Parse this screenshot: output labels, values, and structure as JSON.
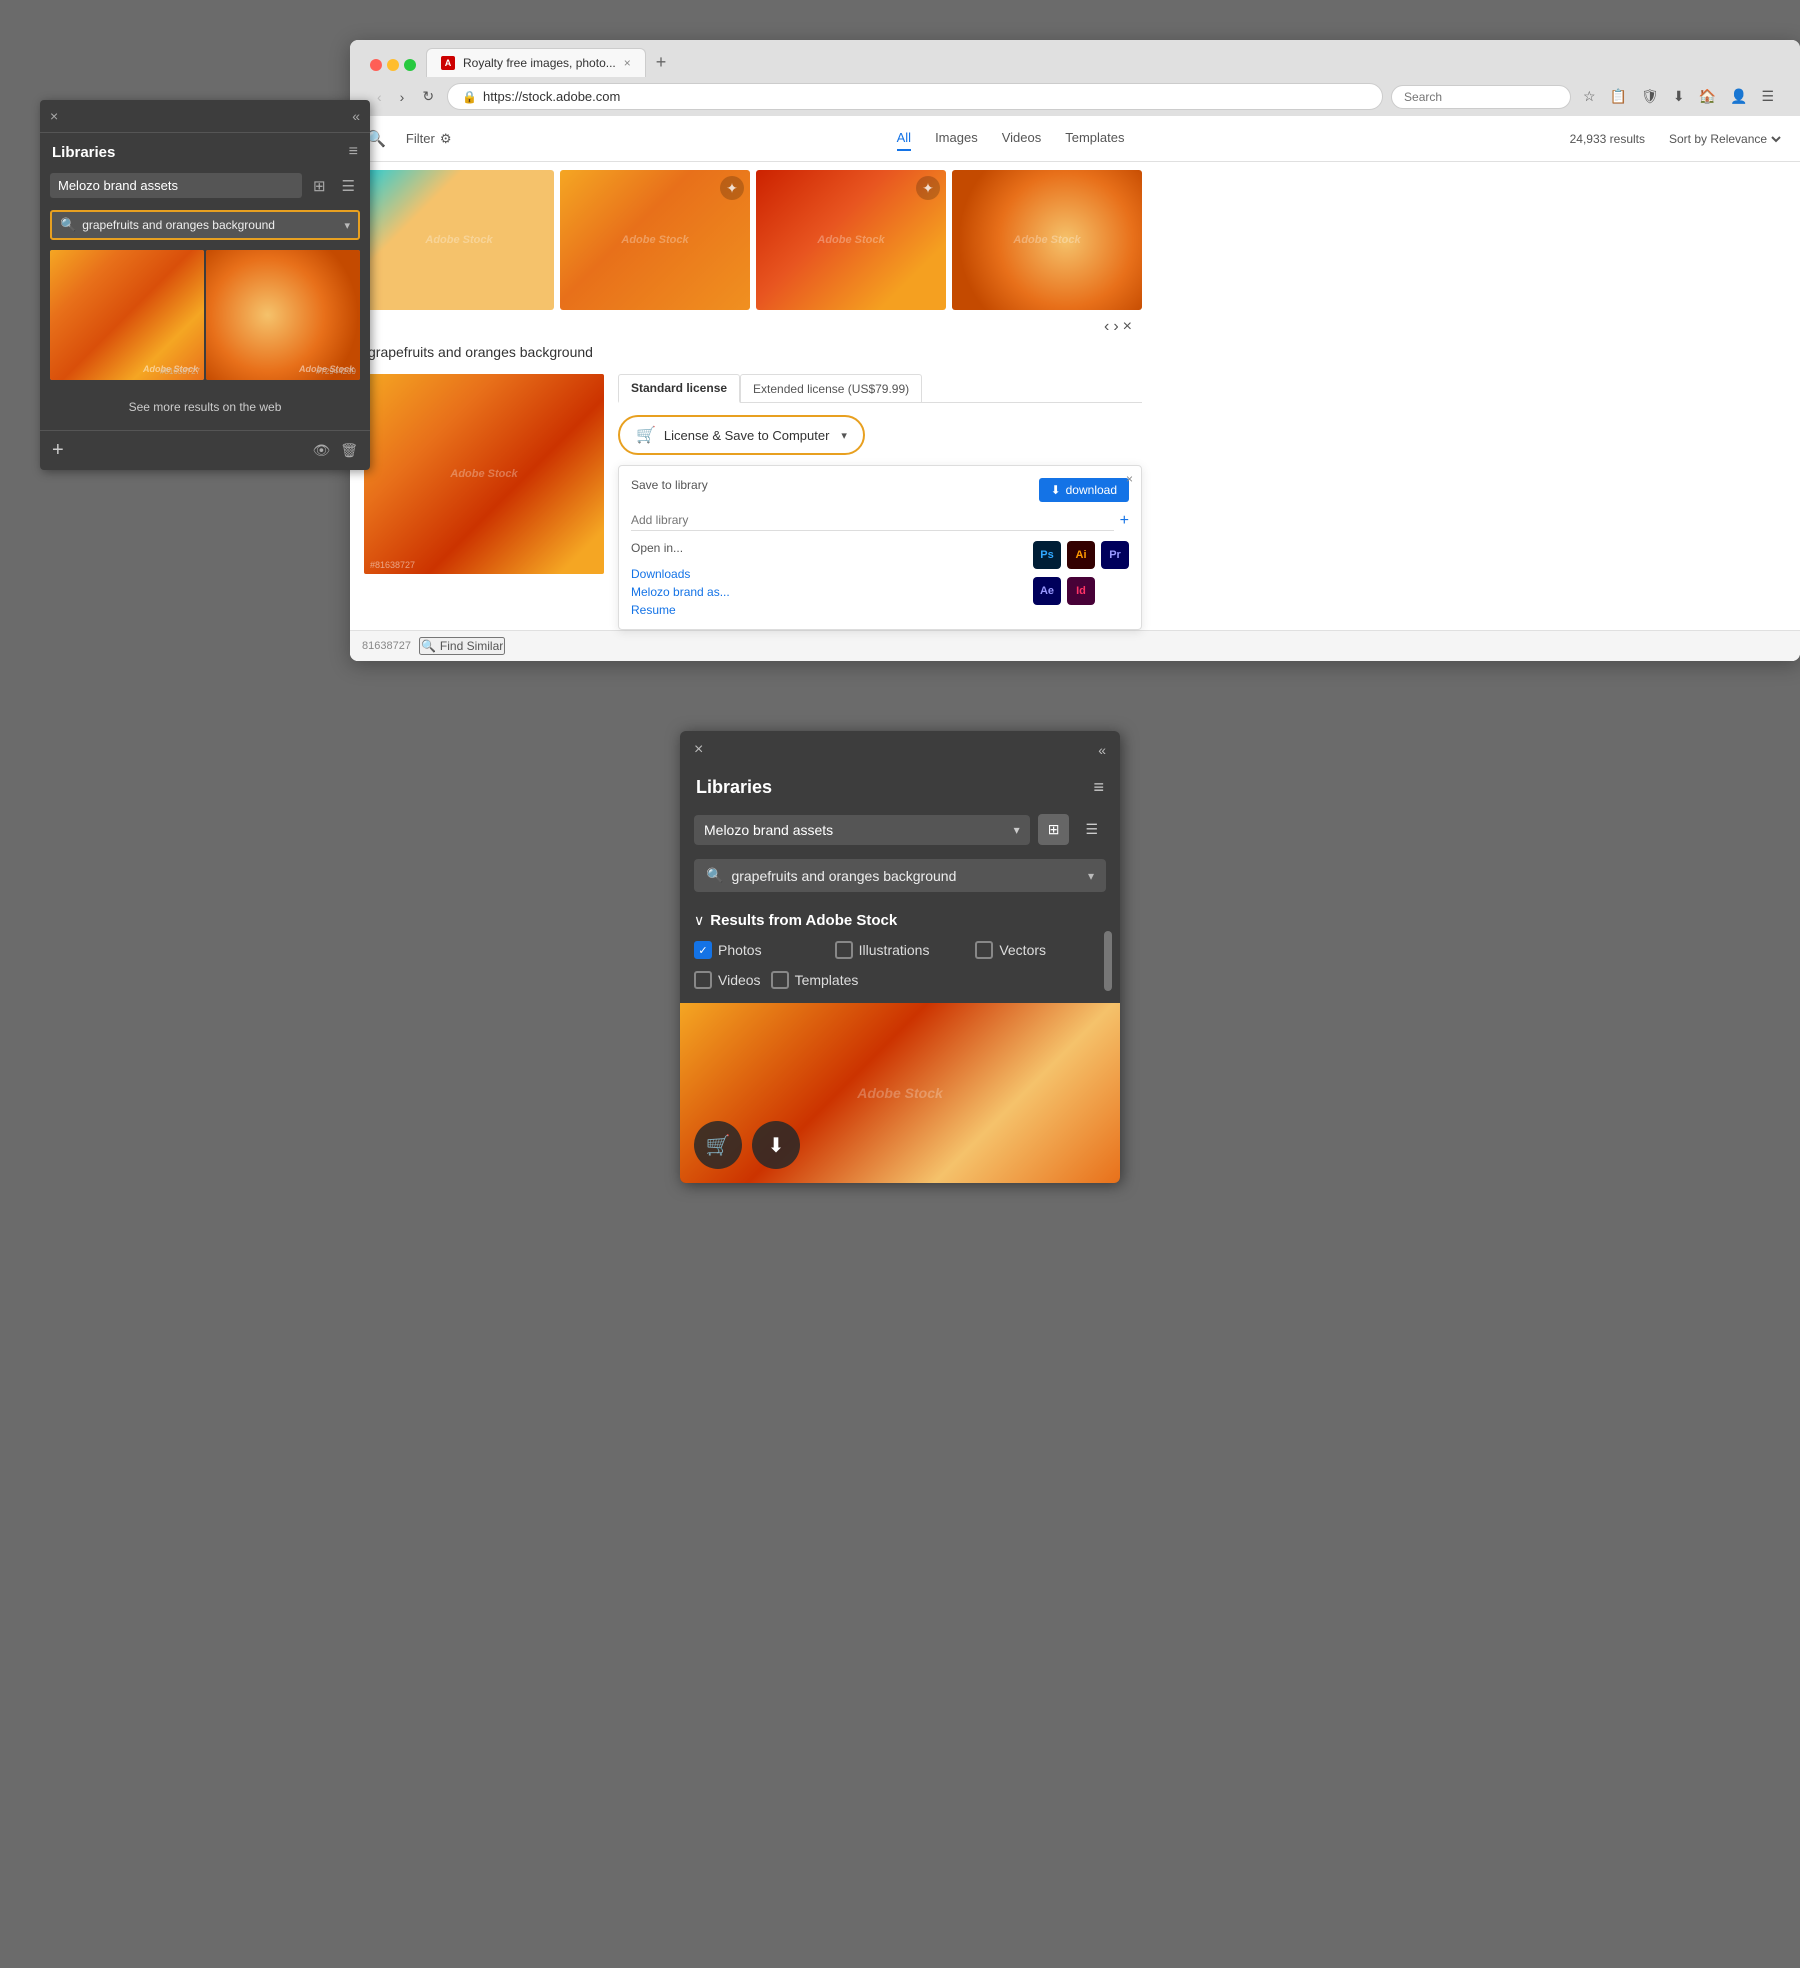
{
  "top_panel": {
    "title": "Libraries",
    "close_label": "×",
    "collapse_label": "«",
    "menu_label": "≡",
    "library_name": "Melozo brand assets",
    "search_query": "grapefruits and oranges background",
    "search_placeholder": "grapefruits and oranges background",
    "image_ids": [
      "#81638727",
      "#72944209"
    ],
    "see_more_text": "See more results on the web",
    "view_grid_label": "⊞",
    "view_list_label": "☰",
    "dropdown_arrow": "▾"
  },
  "browser": {
    "tab_label": "Royalty free images, photo...",
    "tab_favicon": "A",
    "new_tab_label": "+",
    "address": "https://stock.adobe.com",
    "search_placeholder": "Search",
    "back_label": "‹",
    "forward_label": "›",
    "reload_label": "↻",
    "toolbar_icons": [
      "☆",
      "📋",
      "🛡",
      "⬇",
      "🏠",
      "👤",
      "☰"
    ]
  },
  "stock": {
    "search_label": "🔍",
    "filter_label": "Filter",
    "filter_icon": "⚙",
    "tabs": [
      "All",
      "Images",
      "Videos",
      "Templates"
    ],
    "active_tab": "All",
    "results_count": "24,933 results",
    "sort_label": "Sort by Relevance",
    "sort_arrow": "▾",
    "images": [
      {
        "id": "img1",
        "type": "citrus1"
      },
      {
        "id": "img2",
        "type": "citrus2"
      },
      {
        "id": "img3",
        "type": "citrus3"
      },
      {
        "id": "img4",
        "type": "citrus4"
      }
    ],
    "detail": {
      "title": "grapefruits and oranges background",
      "image_id": "#81638727",
      "nav_prev": "‹",
      "nav_next": "›",
      "close": "×",
      "license_tabs": [
        "Standard license",
        "Extended license (US$79.99)"
      ],
      "active_license": "Standard license",
      "license_btn_label": "License & Save to Computer",
      "license_btn_arrow": "▾",
      "license_icon": "🛒",
      "save_to_library": "Save to library",
      "download_btn": "download",
      "download_icon": "⬇",
      "add_library_placeholder": "Add library",
      "add_library_plus": "+",
      "open_in_label": "Open in...",
      "apps": [
        "Ps",
        "Ai",
        "Pr",
        "Ae",
        "Id"
      ],
      "links": [
        "Downloads",
        "Melozo brand as...",
        "Resume"
      ]
    },
    "find_similar": {
      "id_label": "81638727",
      "find_icon": "🔍",
      "find_text": "Find Similar"
    }
  },
  "bottom_panel": {
    "title": "Libraries",
    "close_label": "×",
    "collapse_label": "«",
    "menu_label": "≡",
    "library_name": "Melozo brand assets",
    "search_query": "grapefruits and oranges background",
    "search_placeholder": "grapefruits and oranges background",
    "view_grid_label": "⊞",
    "view_list_label": "☰",
    "dropdown_arrow": "▾",
    "results_section": {
      "chevron": "∨",
      "title": "Results from Adobe Stock",
      "filters": [
        {
          "label": "Photos",
          "checked": true
        },
        {
          "label": "Illustrations",
          "checked": false
        },
        {
          "label": "Vectors",
          "checked": false
        },
        {
          "label": "Videos",
          "checked": false
        },
        {
          "label": "Templates",
          "checked": false
        }
      ]
    },
    "preview_watermark": "Adobe Stock",
    "action_btn_add": "🛒",
    "action_btn_download": "⬇"
  }
}
